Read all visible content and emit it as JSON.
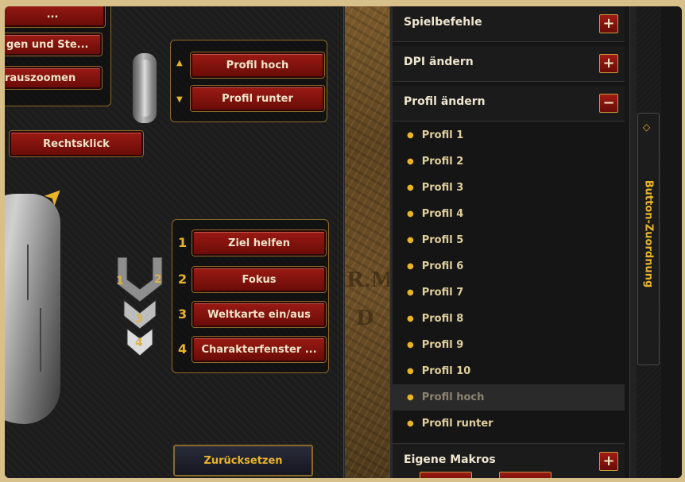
{
  "left": {
    "top_buttons": [
      "...",
      "gen und Ste...",
      "rauszoomen"
    ],
    "right_click_label": "Rechtsklick",
    "profile_up_label": "Profil hoch",
    "profile_down_label": "Profil runter",
    "assignments": [
      {
        "num": "1",
        "label": "Ziel helfen"
      },
      {
        "num": "2",
        "label": "Fokus"
      },
      {
        "num": "3",
        "label": "Weltkarte ein/aus"
      },
      {
        "num": "4",
        "label": "Charakterfenster ..."
      }
    ],
    "chevron_numbers": [
      "1",
      "2",
      "3",
      "4"
    ],
    "reset_label": "Zurücksetzen"
  },
  "map": {
    "letters": [
      "R.M",
      "D"
    ]
  },
  "right": {
    "sections": [
      {
        "title": "Spielbefehle",
        "toggle": "+"
      },
      {
        "title": "DPI ändern",
        "toggle": "+"
      },
      {
        "title": "Profil ändern",
        "toggle": "−"
      }
    ],
    "profile_items": [
      "Profil 1",
      "Profil 2",
      "Profil 3",
      "Profil 4",
      "Profil 5",
      "Profil 6",
      "Profil 7",
      "Profil 8",
      "Profil 9",
      "Profil 10",
      "Profil hoch",
      "Profil runter"
    ],
    "active_item_index": 10,
    "macros_title": "Eigene Makros",
    "macros_toggle": "+",
    "side_tab_label": "Button-Zuordnung"
  },
  "colors": {
    "accent_gold": "#e8b428",
    "button_red": "#8a140e"
  }
}
